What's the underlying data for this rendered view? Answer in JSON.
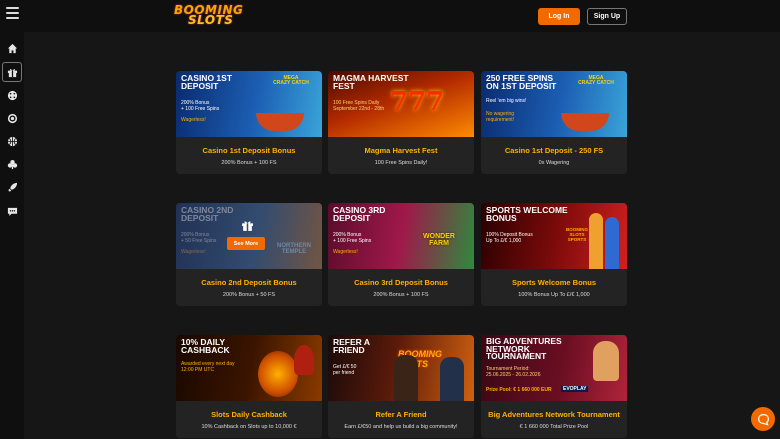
{
  "header": {
    "logo_line1": "BOOMING",
    "logo_line2": "SLOTS",
    "login_label": "Log In",
    "signup_label": "Sign Up"
  },
  "sidebar": {
    "items": [
      {
        "icon": "home-icon"
      },
      {
        "icon": "gift-icon"
      },
      {
        "icon": "dice-icon"
      },
      {
        "icon": "target-icon"
      },
      {
        "icon": "basketball-icon"
      },
      {
        "icon": "club-icon"
      },
      {
        "icon": "rocket-icon"
      },
      {
        "icon": "chat-icon"
      }
    ]
  },
  "colors": {
    "accent": "#f06a00",
    "title": "#ffb000",
    "card_bg": "#232323",
    "page_bg": "#161616"
  },
  "promos": [
    {
      "banner_title": "CASINO 1ST\nDEPOSIT",
      "banner_sub": "200% Bonus\n+ 100 Free Spins",
      "banner_note": "Wagerless!",
      "badge": "MEGA\nCRAZY CATCH",
      "title": "Casino 1st Deposit Bonus",
      "desc": "200% Bonus + 100 FS"
    },
    {
      "banner_title": "MAGMA HARVEST\nFEST",
      "banner_sub": "100 Free Spins Daily\nSeptember 22nd - 28th",
      "banner_note": "777",
      "title": "Magma Harvest Fest",
      "desc": "100 Free Spins Daily!"
    },
    {
      "banner_title": "250 FREE SPINS\nON 1ST DEPOSIT",
      "banner_sub": "Reel 'em big wins!",
      "banner_note": "No wagering\nrequirement!",
      "badge": "MEGA\nCRAZY CATCH",
      "title": "Casino 1st Deposit - 250 FS",
      "desc": "0x Wagering"
    },
    {
      "banner_title": "CASINO 2ND\nDEPOSIT",
      "banner_sub": "200% Bonus\n+ 50 Free Spins",
      "banner_note": "Wagerless!",
      "badge": "NORTHERN\nTEMPLE",
      "see_more": "See More",
      "title": "Casino 2nd Deposit Bonus",
      "desc": "200% Bonus + 50 FS"
    },
    {
      "banner_title": "CASINO 3RD\nDEPOSIT",
      "banner_sub": "200% Bonus\n+ 100 Free Spins",
      "banner_note": "Wagerless!",
      "badge": "WONDER\nFARM",
      "title": "Casino 3rd Deposit Bonus",
      "desc": "200% Bonus + 100 FS"
    },
    {
      "banner_title": "SPORTS WELCOME\nBONUS",
      "banner_sub": "100% Deposit Bonus\nUp To  £/€ 1,000",
      "banner_note": "BOOMING SLOTS SPORTS",
      "title": "Sports Welcome Bonus",
      "desc": "100% Bonus Up To £/€ 1,000"
    },
    {
      "banner_title": "10% DAILY\nCASHBACK",
      "banner_sub": "Awarded every next day\n12:00 PM UTC",
      "banner_note": "",
      "title": "Slots Daily Cashback",
      "desc": "10% Cashback on Slots up to 10,000 €"
    },
    {
      "banner_title": "REFER A\nFRIEND",
      "banner_sub": "Get £/€ 50\nper friend",
      "banner_note": "BOOMING SLOTS",
      "title": "Refer A Friend",
      "desc": "Earn £/€50 and help us build a big community!"
    },
    {
      "banner_title": "BIG ADVENTURES\nNETWORK\nTOURNAMENT",
      "banner_sub": "Tournament Period:\n25.06.2025 - 26.02.2026",
      "banner_note": "Prize Pool: € 1 660 000 EUR",
      "badge": "EVOPLAY",
      "title": "Big Adventures Network Tournament",
      "desc": "€ 1 660 000 Total Prize Pool"
    }
  ]
}
